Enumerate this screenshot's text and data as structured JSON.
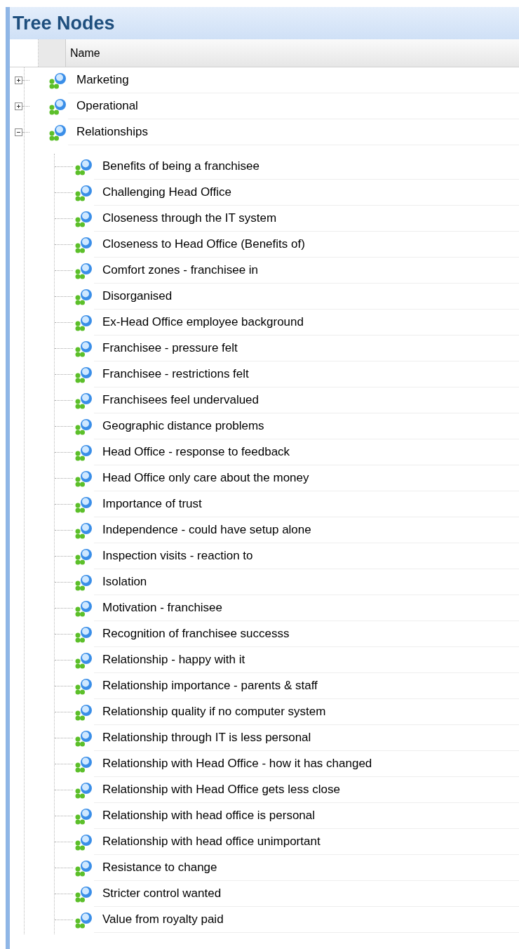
{
  "panel": {
    "title": "Tree Nodes"
  },
  "columns": [
    "Name"
  ],
  "nodes": [
    {
      "name": "Marketing",
      "expanded": false
    },
    {
      "name": "Operational",
      "expanded": false
    },
    {
      "name": "Relationships",
      "expanded": true,
      "children": [
        {
          "name": "Benefits of being a franchisee"
        },
        {
          "name": "Challenging Head Office"
        },
        {
          "name": "Closeness through the IT system"
        },
        {
          "name": "Closeness to Head Office (Benefits of)"
        },
        {
          "name": "Comfort zones - franchisee in"
        },
        {
          "name": "Disorganised"
        },
        {
          "name": "Ex-Head Office employee background"
        },
        {
          "name": "Franchisee - pressure felt"
        },
        {
          "name": "Franchisee - restrictions felt"
        },
        {
          "name": "Franchisees feel undervalued"
        },
        {
          "name": "Geographic distance problems"
        },
        {
          "name": "Head Office - response to feedback"
        },
        {
          "name": "Head Office only care about the money"
        },
        {
          "name": "Importance of trust"
        },
        {
          "name": "Independence - could have setup alone"
        },
        {
          "name": "Inspection visits - reaction to"
        },
        {
          "name": "Isolation"
        },
        {
          "name": "Motivation - franchisee"
        },
        {
          "name": "Recognition of franchisee successs"
        },
        {
          "name": "Relationship - happy with it"
        },
        {
          "name": "Relationship importance - parents & staff"
        },
        {
          "name": "Relationship quality if no computer system"
        },
        {
          "name": "Relationship through IT is less personal"
        },
        {
          "name": "Relationship with Head Office - how it has changed"
        },
        {
          "name": "Relationship with Head Office gets less close"
        },
        {
          "name": "Relationship with head office is personal"
        },
        {
          "name": "Relationship with head office unimportant"
        },
        {
          "name": "Resistance to change"
        },
        {
          "name": "Stricter control wanted"
        },
        {
          "name": "Value from royalty paid"
        }
      ]
    }
  ]
}
